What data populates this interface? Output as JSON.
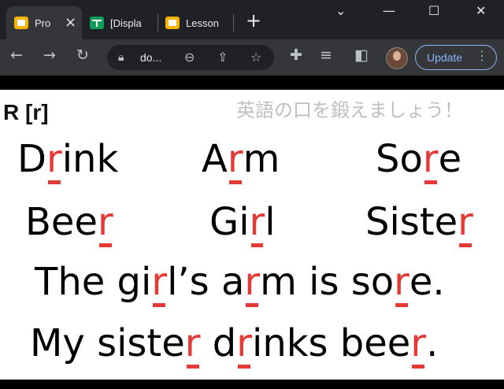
{
  "browser": {
    "tabs": [
      {
        "title": "Pro",
        "icon": "slides-icon",
        "active": true
      },
      {
        "title": "[Displa",
        "icon": "sheets-icon",
        "active": false
      },
      {
        "title": "Lesson",
        "icon": "slides-icon",
        "active": false
      }
    ],
    "new_tab_label": "+",
    "window_controls": {
      "collapse": "⌄",
      "minimize": "—",
      "maximize": "☐",
      "close": "✕"
    },
    "address": "do...",
    "update_button": "Update"
  },
  "slide": {
    "sound_label": "R [r]",
    "subtitle": "英語の口を鍛えましょう！",
    "words": [
      {
        "pre": "D",
        "r": "r",
        "post": "ink"
      },
      {
        "pre": "A",
        "r": "r",
        "post": "m"
      },
      {
        "pre": "So",
        "r": "r",
        "post": "e"
      },
      {
        "pre": "Bee",
        "r": "r",
        "post": ""
      },
      {
        "pre": "Gi",
        "r": "r",
        "post": "l"
      },
      {
        "pre": "Siste",
        "r": "r",
        "post": ""
      }
    ],
    "sentence1": {
      "a": "The gi",
      "r1": "r",
      "b": "l’s a",
      "r2": "r",
      "c": "m is so",
      "r3": "r",
      "d": "e."
    },
    "sentence2": {
      "a": "My siste",
      "r1": "r",
      "b": " d",
      "r2": "r",
      "c": "inks bee",
      "r3": "r",
      "d": "."
    }
  },
  "colors": {
    "accent_red": "#e53935",
    "chrome_dark": "#202124",
    "chrome_mid": "#35363a"
  }
}
